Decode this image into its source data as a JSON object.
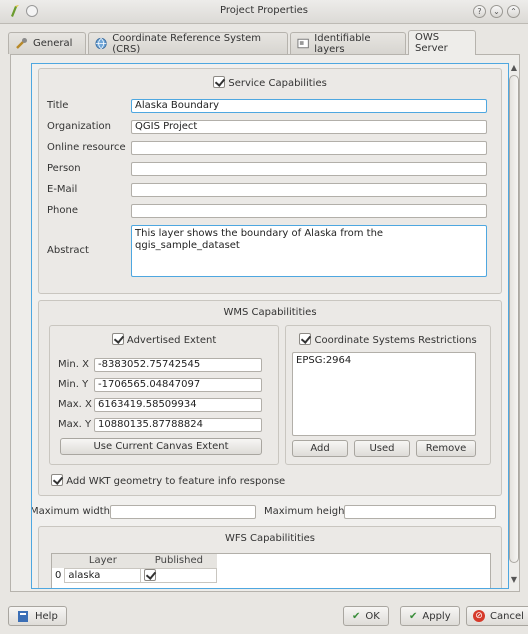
{
  "window": {
    "title": "Project Properties"
  },
  "tabs": [
    {
      "label": "General",
      "icon": "tools-icon"
    },
    {
      "label": "Coordinate Reference System (CRS)",
      "icon": "globe-icon"
    },
    {
      "label": "Identifiable layers",
      "icon": "layers-icon"
    },
    {
      "label": "OWS Server",
      "icon": ""
    }
  ],
  "service": {
    "checkbox_label": "Service Capabilities",
    "fields": {
      "title": {
        "label": "Title",
        "value": "Alaska Boundary"
      },
      "organization": {
        "label": "Organization",
        "value": "QGIS Project"
      },
      "online_resource": {
        "label": "Online resource",
        "value": ""
      },
      "person": {
        "label": "Person",
        "value": ""
      },
      "email": {
        "label": "E-Mail",
        "value": ""
      },
      "phone": {
        "label": "Phone",
        "value": ""
      },
      "abstract": {
        "label": "Abstract",
        "value": "This layer shows the boundary of Alaska from the qgis_sample_dataset"
      }
    }
  },
  "wms": {
    "title": "WMS Capabilitities",
    "extent": {
      "checkbox_label": "Advertised Extent",
      "min_x": {
        "label": "Min. X",
        "value": "-8383052.75742545"
      },
      "min_y": {
        "label": "Min. Y",
        "value": "-1706565.04847097"
      },
      "max_x": {
        "label": "Max. X",
        "value": "6163419.58509934"
      },
      "max_y": {
        "label": "Max. Y",
        "value": "10880135.87788824"
      },
      "button": "Use Current Canvas Extent"
    },
    "crs": {
      "checkbox_label": "Coordinate Systems Restrictions",
      "items": [
        "EPSG:2964"
      ],
      "buttons": {
        "add": "Add",
        "used": "Used",
        "remove": "Remove"
      }
    },
    "wkt_checkbox_label": "Add WKT geometry to feature info response",
    "max_width_label": "Maximum width",
    "max_width_value": "",
    "max_height_label": "Maximum height",
    "max_height_value": ""
  },
  "wfs": {
    "title": "WFS Capabilitities",
    "columns": [
      "Layer",
      "Published"
    ],
    "rows": [
      {
        "index": "0",
        "layer": "alaska",
        "published": true
      }
    ]
  },
  "buttons": {
    "help": "Help",
    "ok": "OK",
    "apply": "Apply",
    "cancel": "Cancel"
  },
  "colors": {
    "focus": "#4ea7e0",
    "cancel_icon": "#d63a2a",
    "ok_icon": "#3a8d3a"
  }
}
